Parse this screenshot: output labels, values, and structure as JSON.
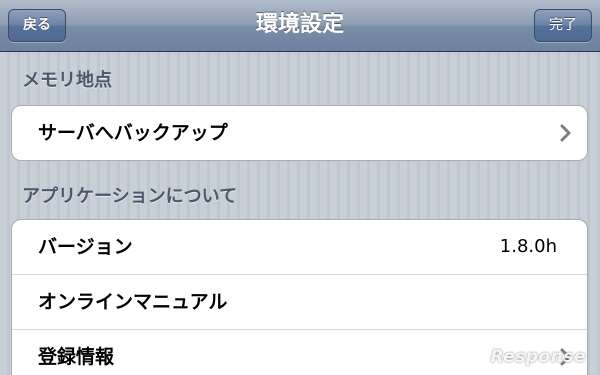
{
  "navbar": {
    "back_label": "戻る",
    "title": "環境設定",
    "done_label": "完了"
  },
  "sections": [
    {
      "header": "メモリ地点",
      "rows": [
        {
          "label": "サーバへバックアップ",
          "value": "",
          "icon": "chevron-right-icon"
        }
      ]
    },
    {
      "header": "アプリケーションについて",
      "rows": [
        {
          "label": "バージョン",
          "value": "1.8.0h"
        },
        {
          "label": "オンラインマニュアル",
          "value": ""
        },
        {
          "label": "登録情報",
          "value": "",
          "icon": "chevron-right-icon"
        }
      ]
    }
  ],
  "watermark": "Response",
  "colors": {
    "navbar_bg": "#7a8da6",
    "page_bg": "#c5ccd4",
    "section_header_text": "#4c566c",
    "chevron": "#7f7f7f"
  }
}
